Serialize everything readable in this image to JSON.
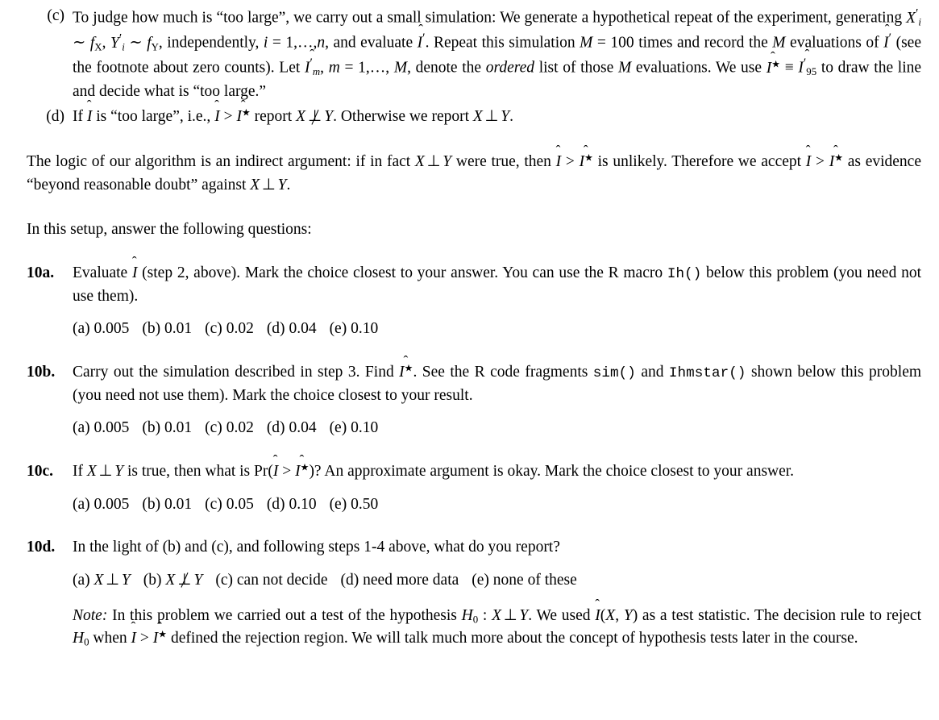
{
  "document": {
    "items": [
      {
        "id": "item-c",
        "label": "(c)",
        "text_1": "To judge how much is “too large”, we carry out a small simulation: We generate a hypothetical repeat of the experiment, generating ",
        "text_2": " ∼ ",
        "text_3": ", ",
        "text_4": " ∼ ",
        "text_5": ", independently, ",
        "text_6": " = 1,…,",
        "text_7": ", and evaluate ",
        "text_8": ". Repeat this simulation ",
        "text_9": " = 100 times and record the ",
        "text_10": " evaluations of ",
        "text_11": " (see the footnote about zero counts). Let ",
        "text_12": ", ",
        "text_13": " = 1,…, ",
        "text_14": ", denote the ",
        "text_15": "ordered",
        "text_16": " list of those ",
        "text_17": " evaluations. We use ",
        "text_18": " ≡ ",
        "text_19": " to draw the line and decide what is “too large.”"
      },
      {
        "id": "item-d",
        "label": "(d)",
        "text_1": "If ",
        "text_2": " is “too large”, i.e., ",
        "text_3": " > ",
        "text_4": " report ",
        "text_5": ". Otherwise we report ",
        "text_6": "."
      }
    ],
    "logic_paragraph": {
      "text_1": "The logic of our algorithm is an indirect argument: if in fact ",
      "text_2": " were true, then ",
      "text_3": " > ",
      "text_4": " is unlikely. Therefore we accept ",
      "text_5": " > ",
      "text_6": " as evidence “beyond reasonable doubt” against ",
      "text_7": "."
    },
    "setup_line": "In this setup, answer the following questions:",
    "questions": [
      {
        "id": "q-10a",
        "label": "10a.",
        "text_1": "Evaluate ",
        "text_2": " (step 2, above). Mark the choice closest to your answer. You can use the R macro ",
        "macro_1": "Ih()",
        "text_3": " below this problem (you need not use them).",
        "choices": [
          {
            "key": "(a)",
            "value": "0.005"
          },
          {
            "key": "(b)",
            "value": "0.01"
          },
          {
            "key": "(c)",
            "value": "0.02"
          },
          {
            "key": "(d)",
            "value": "0.04"
          },
          {
            "key": "(e)",
            "value": "0.10"
          }
        ]
      },
      {
        "id": "q-10b",
        "label": "10b.",
        "text_1": "Carry out the simulation described in step 3. Find ",
        "text_2": ". See the R code fragments ",
        "macro_1": "sim()",
        "text_3": " and ",
        "macro_2": "Ihmstar()",
        "text_4": " shown below this problem (you need not use them). Mark the choice closest to your result.",
        "choices": [
          {
            "key": "(a)",
            "value": "0.005"
          },
          {
            "key": "(b)",
            "value": "0.01"
          },
          {
            "key": "(c)",
            "value": "0.02"
          },
          {
            "key": "(d)",
            "value": "0.04"
          },
          {
            "key": "(e)",
            "value": "0.10"
          }
        ]
      },
      {
        "id": "q-10c",
        "label": "10c.",
        "text_1": "If ",
        "text_2": " is true, then what is Pr(",
        "text_3": " > ",
        "text_4": ")? An approximate argument is okay. Mark the choice closest to your answer.",
        "choices": [
          {
            "key": "(a)",
            "value": "0.005"
          },
          {
            "key": "(b)",
            "value": "0.01"
          },
          {
            "key": "(c)",
            "value": "0.05"
          },
          {
            "key": "(d)",
            "value": "0.10"
          },
          {
            "key": "(e)",
            "value": "0.50"
          }
        ]
      },
      {
        "id": "q-10d",
        "label": "10d.",
        "text_1": "In the light of (b) and (c), and following steps 1-4 above, what do you report?",
        "choices": [
          {
            "key": "(a)",
            "value": "X ⊥ Y"
          },
          {
            "key": "(b)",
            "value": "X ⊥̸ Y"
          },
          {
            "key": "(c)",
            "value": "can not decide"
          },
          {
            "key": "(d)",
            "value": "need more data"
          },
          {
            "key": "(e)",
            "value": "none of these"
          }
        ],
        "note": {
          "lead": "Note:",
          "text_1": " In this problem we carried out a test of the hypothesis ",
          "text_2": " : ",
          "text_3": ". We used ",
          "text_4": "(",
          "text_5": ", ",
          "text_6": ") as a test statistic. The decision rule to reject ",
          "text_7": " when ",
          "text_8": " > ",
          "text_9": " defined the rejection region. We will talk much more about the concept of hypothesis tests later in the course."
        }
      }
    ],
    "symbols": {
      "I": "I",
      "hat": "ˆ",
      "star": "★",
      "prime": "′",
      "perp": "⊥",
      "X": "X",
      "Y": "Y",
      "M": "M",
      "m": "m",
      "n": "n",
      "i": "i",
      "f": "f",
      "H": "H",
      "sub_95": "95",
      "sub_0": "0"
    }
  }
}
